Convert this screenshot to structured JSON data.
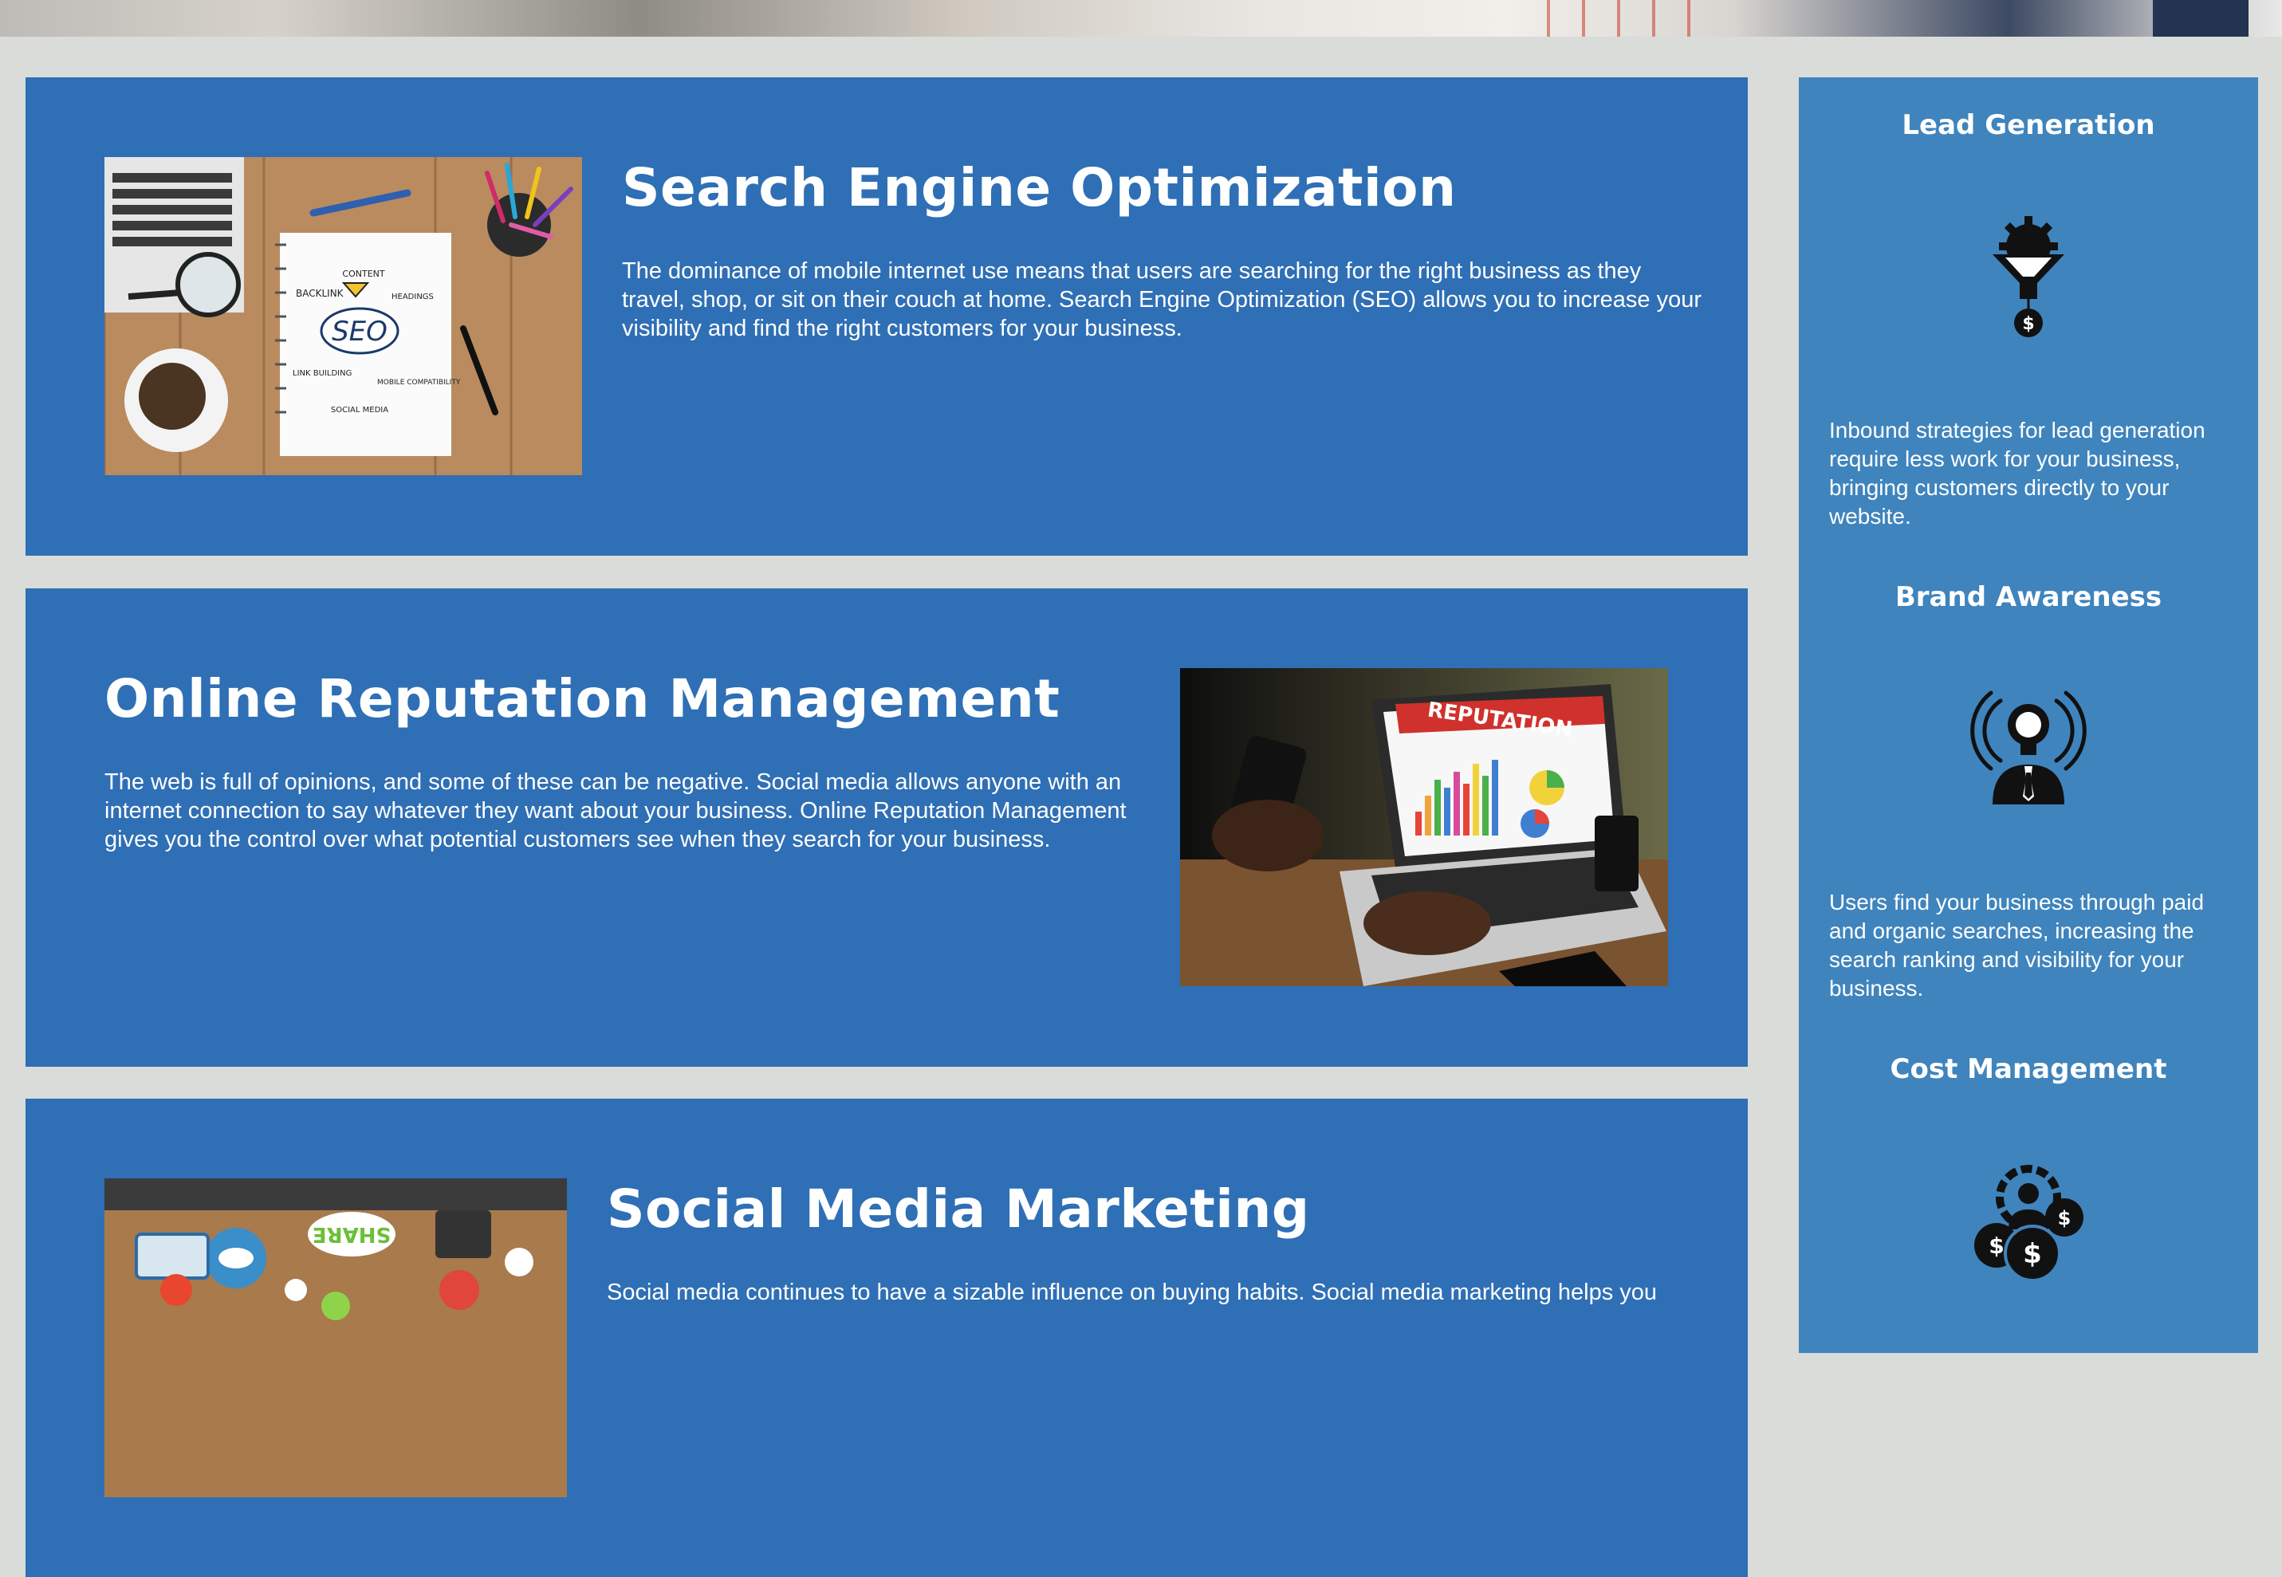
{
  "colors": {
    "page_background": "#d9dcd8",
    "card_blue": "#2f6fb5",
    "sidebar_blue": "#3f84bd",
    "text": "#ffffff"
  },
  "hero": {
    "image_icon": "office-desk-photo"
  },
  "services": [
    {
      "title": "Search Engine Optimization",
      "text": "The dominance of mobile internet use means that users are searching for the right business as they travel, shop, or sit on their couch at home. Search Engine Optimization (SEO) allows you to increase your visibility and find the right customers for your business.",
      "image_icon": "seo-notebook-photo",
      "image_labels": {
        "seo": "SEO",
        "content": "CONTENT",
        "backlink": "BACKLINK",
        "headings": "HEADINGS",
        "link_building": "LINK BUILDING",
        "mobile": "MOBILE COMPATIBILITY",
        "social": "SOCIAL MEDIA"
      }
    },
    {
      "title": "Online Reputation Management",
      "text": "The web is full of opinions, and some of these can be negative. Social media allows anyone with an internet connection to say whatever they want about your business. Online Reputation Management gives you the control over what potential customers see when they search for your business.",
      "image_icon": "reputation-laptop-photo",
      "image_labels": {
        "reputation": "REPUTATION"
      }
    },
    {
      "title": "Social Media Marketing",
      "text": "Social media continues to have a sizable influence on buying habits. Social media marketing helps you",
      "image_icon": "social-share-table-photo",
      "image_labels": {
        "share": "SHARE"
      }
    }
  ],
  "benefits": [
    {
      "title": "Lead Generation",
      "icon": "funnel-gear-dollar-icon",
      "text": "Inbound strategies for lead generation require less work for your business, bringing customers directly to your website."
    },
    {
      "title": "Brand Awareness",
      "icon": "lightbulb-person-broadcast-icon",
      "text": "Users find your business through paid and organic searches, increasing the search ranking and visibility for your business."
    },
    {
      "title": "Cost Management",
      "icon": "gear-person-coins-icon",
      "text": ""
    }
  ]
}
